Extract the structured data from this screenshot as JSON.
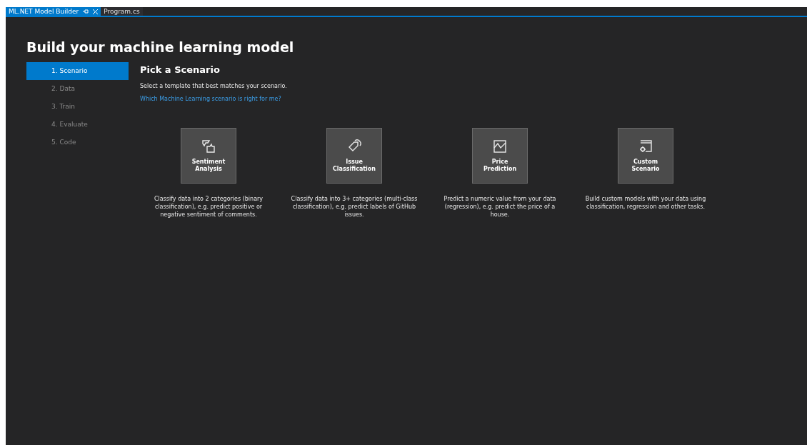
{
  "tabs": [
    {
      "label": "ML.NET Model Builder",
      "selected": true,
      "pinnable": true
    },
    {
      "label": "Program.cs",
      "selected": false,
      "pinnable": false
    }
  ],
  "title": "Build your machine learning model",
  "steps": [
    {
      "label": "1. Scenario",
      "selected": true
    },
    {
      "label": "2. Data",
      "selected": false
    },
    {
      "label": "3. Train",
      "selected": false
    },
    {
      "label": "4. Evaluate",
      "selected": false
    },
    {
      "label": "5. Code",
      "selected": false
    }
  ],
  "heading": "Pick a Scenario",
  "intro": "Select a template that best matches your scenario.",
  "help_link": "Which Machine Learning scenario is right for me?",
  "scenarios": [
    {
      "kind": "sentiment",
      "name": "Sentiment Analysis",
      "description": "Classify data into 2 categories (binary classification), e.g. predict positive or negative sentiment of comments."
    },
    {
      "kind": "issue",
      "name": "Issue Classification",
      "description": "Classify data into 3+ categories (multi-class classification), e.g. predict labels of GitHub issues."
    },
    {
      "kind": "price",
      "name": "Price Prediction",
      "description": "Predict a numeric value from your data (regression), e.g. predict the price of a house."
    },
    {
      "kind": "custom",
      "name": "Custom Scenario",
      "description": "Build custom models with your data using classification, regression and other tasks."
    }
  ]
}
